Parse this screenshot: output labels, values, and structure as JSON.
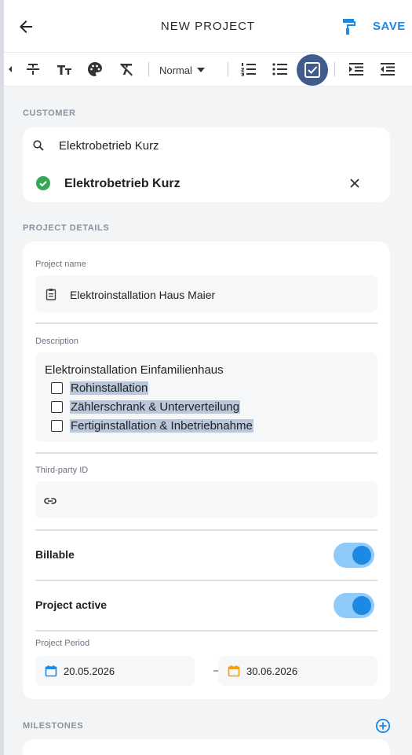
{
  "appbar": {
    "title": "NEW PROJECT",
    "save_label": "SAVE"
  },
  "toolbar": {
    "format_select": "Normal",
    "icons": [
      "chevron-left-icon",
      "strikethrough-icon",
      "text-size-icon",
      "palette-icon",
      "clear-format-icon",
      "ordered-list-icon",
      "bullet-list-icon",
      "checklist-icon",
      "indent-icon",
      "outdent-icon"
    ],
    "active_button": "checklist"
  },
  "customer": {
    "section_label": "CUSTOMER",
    "search_value": "Elektrobetrieb Kurz",
    "selected": "Elektrobetrieb Kurz"
  },
  "details": {
    "section_label": "PROJECT DETAILS",
    "name_label": "Project name",
    "name_value": "Elektroinstallation Haus Maier",
    "description_label": "Description",
    "description_text": "Elektroinstallation Einfamilienhaus",
    "tasks": [
      "Rohinstallation",
      "Zählerschrank & Unterverteilung",
      "Fertiginstallation & Inbetriebnahme"
    ],
    "third_party_label": "Third-party ID",
    "third_party_value": "",
    "billable_label": "Billable",
    "billable": true,
    "active_label": "Project active",
    "active": true,
    "period_label": "Project Period",
    "period_start": "20.05.2026",
    "period_end": "30.06.2026"
  },
  "milestones": {
    "section_label": "MILESTONES"
  },
  "colors": {
    "accent": "#1e88e5",
    "toggle_track": "#90caf9",
    "active_tool": "#3f5c8c",
    "success": "#34a853",
    "end_date_icon": "#f59e0b"
  }
}
